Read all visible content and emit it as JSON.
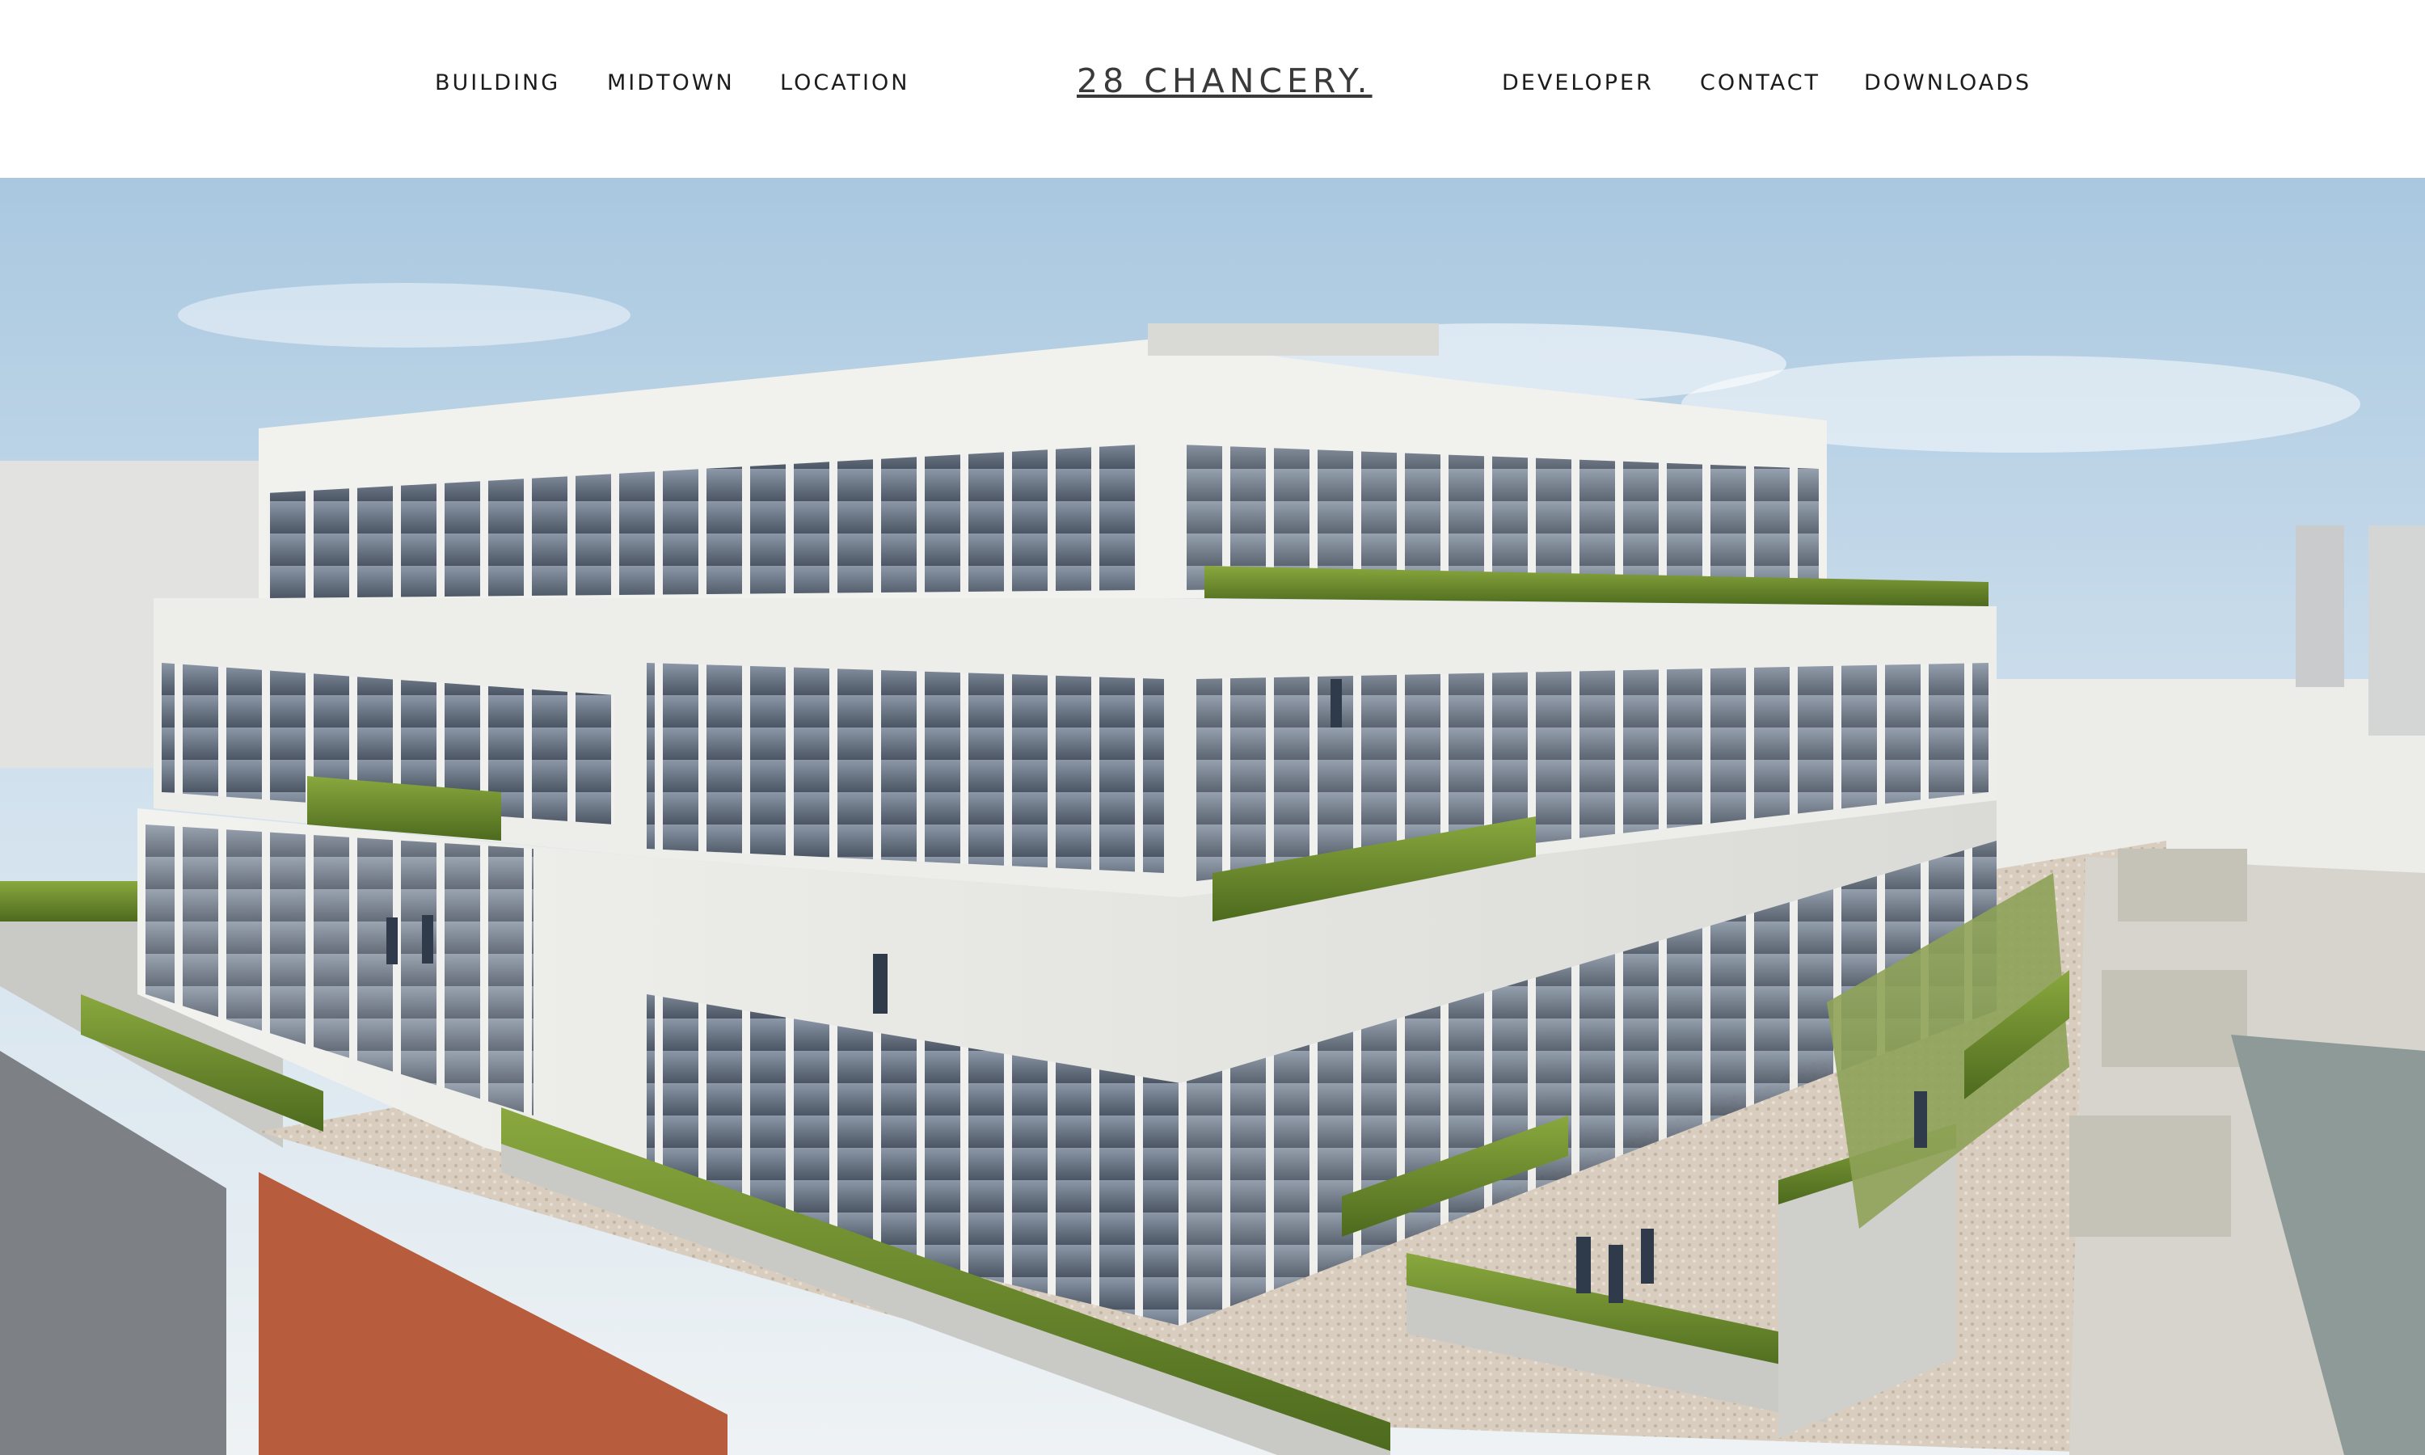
{
  "header": {
    "nav_left": [
      "BUILDING",
      "MIDTOWN",
      "LOCATION"
    ],
    "logo": "28 CHANCERY.",
    "nav_right": [
      "DEVELOPER",
      "CONTACT",
      "DOWNLOADS"
    ]
  },
  "hero": {
    "image_subject": "rooftop-terrace-rendering"
  },
  "colors": {
    "background": "#ffffff",
    "nav_text": "#1c1c1c",
    "logo_text": "#3a3a3a",
    "sky": "#c9dcea",
    "facade": "#e9e9e6",
    "planting": "#6f8f2e"
  }
}
